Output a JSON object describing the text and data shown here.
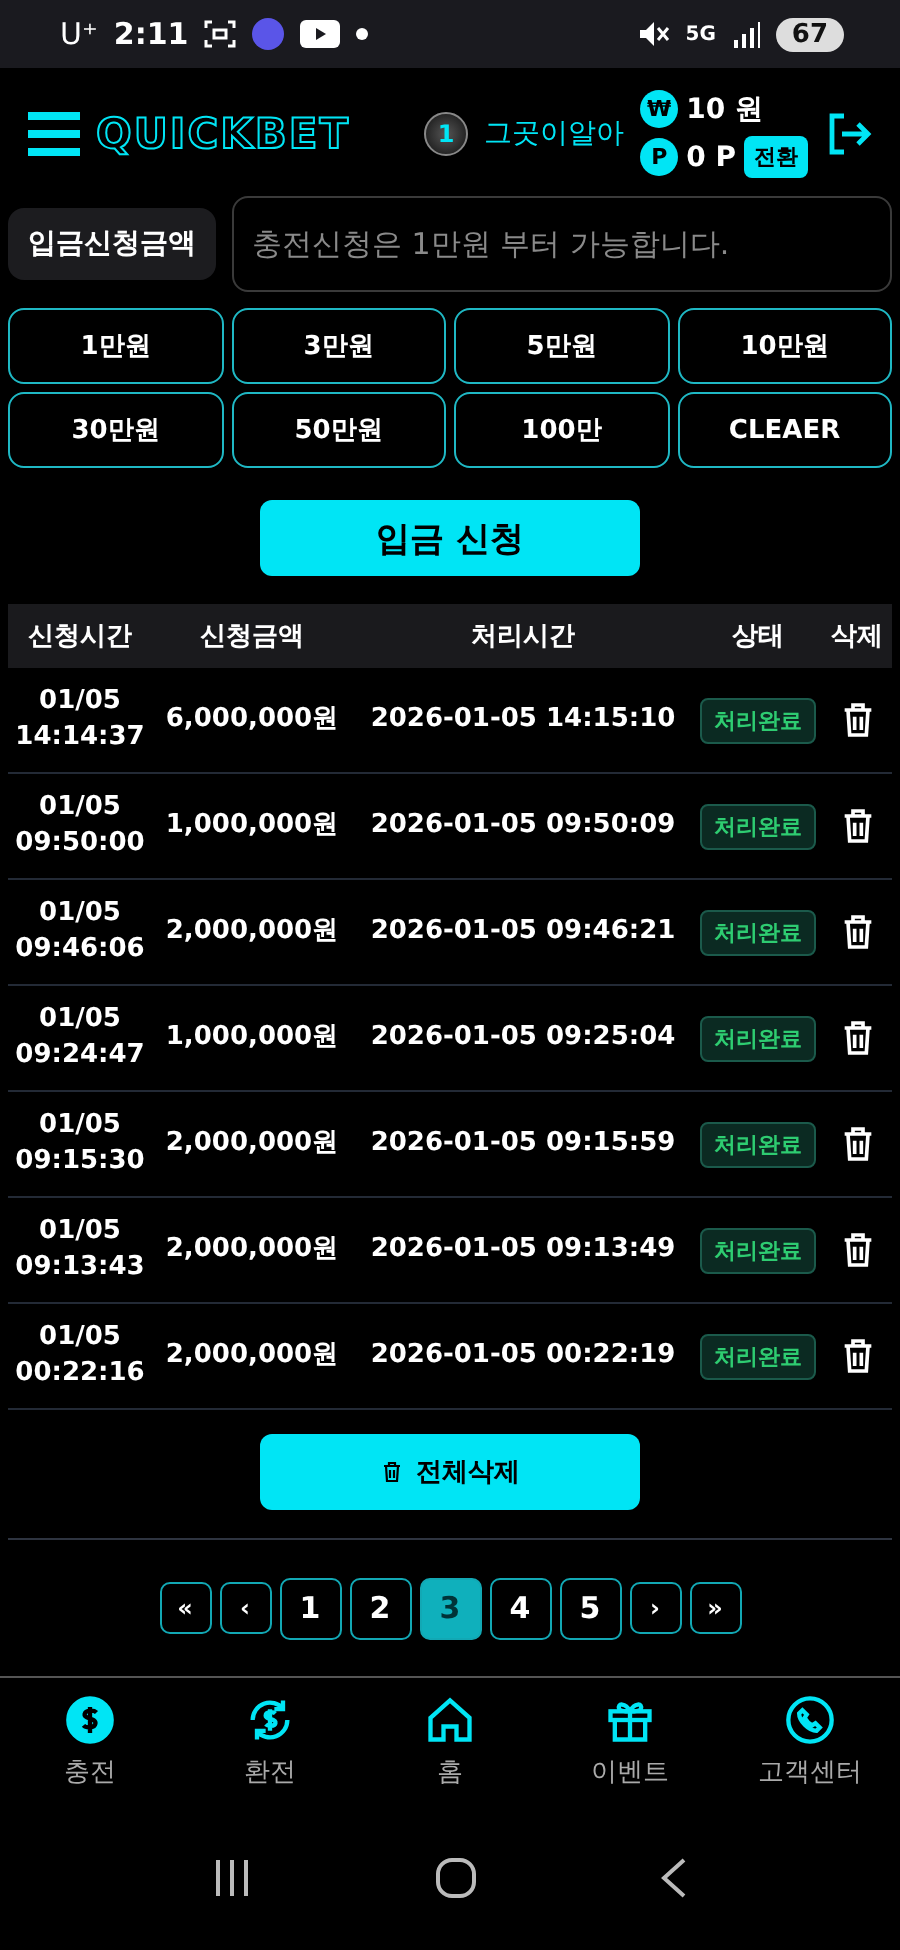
{
  "status_bar": {
    "carrier": "U⁺",
    "time": "2:11",
    "network": "5G",
    "battery": "67"
  },
  "header": {
    "logo": "QUICKBET",
    "level_badge": "1",
    "username": "그곳이알아",
    "money": {
      "symbol": "₩",
      "value": "10 원"
    },
    "points": {
      "symbol": "P",
      "value": "0 P",
      "button": "전환"
    }
  },
  "deposit": {
    "label": "입금신청금액",
    "placeholder": "충전신청은 1만원 부터 가능합니다.",
    "amounts": [
      "1만원",
      "3만원",
      "5만원",
      "10만원",
      "30만원",
      "50만원",
      "100만",
      "CLEAER"
    ],
    "submit": "입금 신청"
  },
  "table": {
    "columns": [
      "신청시간",
      "신청금액",
      "처리시간",
      "상태",
      "삭제"
    ],
    "rows": [
      {
        "requested": [
          "01/05",
          "14:14:37"
        ],
        "amount": "6,000,000원",
        "processed": "2026-01-05 14:15:10",
        "status": "처리완료"
      },
      {
        "requested": [
          "01/05",
          "09:50:00"
        ],
        "amount": "1,000,000원",
        "processed": "2026-01-05 09:50:09",
        "status": "처리완료"
      },
      {
        "requested": [
          "01/05",
          "09:46:06"
        ],
        "amount": "2,000,000원",
        "processed": "2026-01-05 09:46:21",
        "status": "처리완료"
      },
      {
        "requested": [
          "01/05",
          "09:24:47"
        ],
        "amount": "1,000,000원",
        "processed": "2026-01-05 09:25:04",
        "status": "처리완료"
      },
      {
        "requested": [
          "01/05",
          "09:15:30"
        ],
        "amount": "2,000,000원",
        "processed": "2026-01-05 09:15:59",
        "status": "처리완료"
      },
      {
        "requested": [
          "01/05",
          "09:13:43"
        ],
        "amount": "2,000,000원",
        "processed": "2026-01-05 09:13:49",
        "status": "처리완료"
      },
      {
        "requested": [
          "01/05",
          "00:22:16"
        ],
        "amount": "2,000,000원",
        "processed": "2026-01-05 00:22:19",
        "status": "처리완료"
      }
    ]
  },
  "delete_all": "전체삭제",
  "pagination": {
    "first": "«",
    "prev": "‹",
    "pages": [
      {
        "label": "1",
        "selected": false
      },
      {
        "label": "2",
        "selected": false
      },
      {
        "label": "3",
        "selected": true
      },
      {
        "label": "4",
        "selected": false
      },
      {
        "label": "5",
        "selected": false
      }
    ],
    "next": "›",
    "last": "»"
  },
  "bottom_nav": [
    {
      "kind": "deposit",
      "label": "충전",
      "selected": true
    },
    {
      "kind": "exchange",
      "label": "환전",
      "selected": false
    },
    {
      "kind": "home",
      "label": "홈",
      "selected": false
    },
    {
      "kind": "event",
      "label": "이벤트",
      "selected": false
    },
    {
      "kind": "support",
      "label": "고객센터",
      "selected": false
    }
  ]
}
